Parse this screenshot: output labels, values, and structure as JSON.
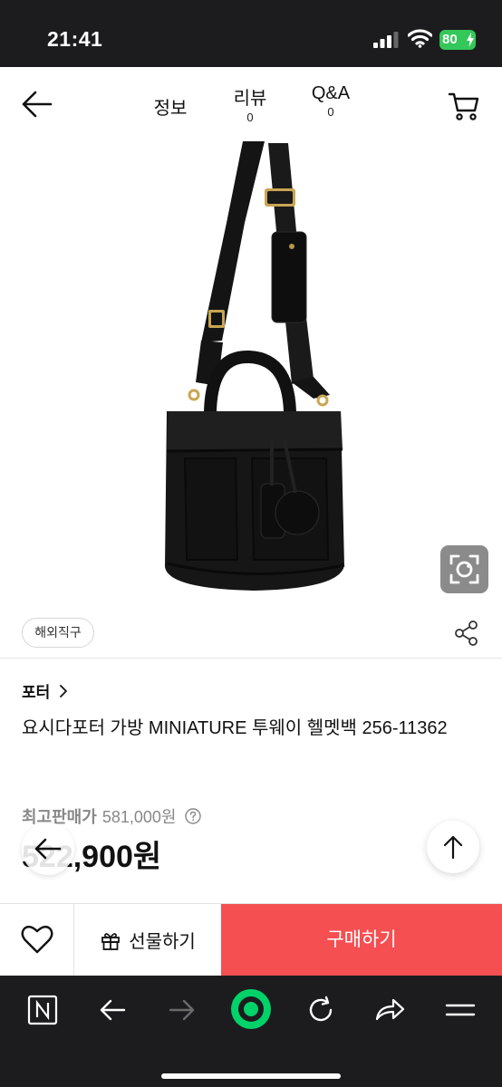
{
  "status_bar": {
    "time": "21:41",
    "battery": "80"
  },
  "header": {
    "tabs": [
      {
        "label": "정보"
      },
      {
        "label": "리뷰",
        "count": "0"
      },
      {
        "label": "Q&A",
        "count": "0"
      }
    ]
  },
  "tags": {
    "chip": "해외직구"
  },
  "product": {
    "brand": "포터",
    "title": "요시다포터 가방 MINIATURE 투웨이 헬멧백 256-11362",
    "price_label": "최고판매가",
    "original_price": "581,000원",
    "sale_price": "522,900원"
  },
  "actions": {
    "gift_label": "선물하기",
    "buy_label": "구매하기"
  },
  "colors": {
    "buy": "#f54f52",
    "accent_green": "#00d26a",
    "battery": "#34c759"
  },
  "icons": [
    "back-arrow-icon",
    "cart-icon",
    "camera-search-icon",
    "share-icon",
    "help-icon",
    "heart-icon",
    "gift-icon",
    "naver-icon",
    "refresh-icon",
    "menu-icon"
  ]
}
